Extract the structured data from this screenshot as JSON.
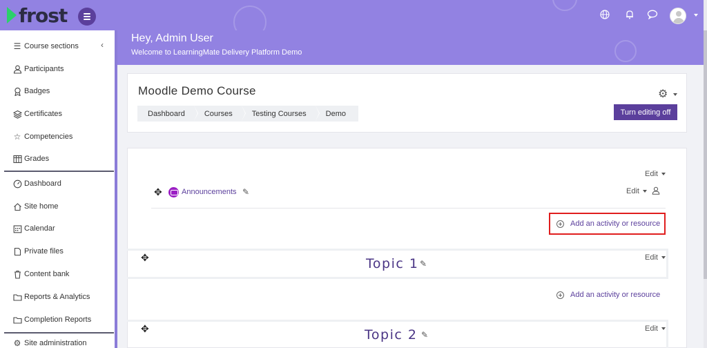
{
  "header": {
    "logo_text": "frost",
    "greeting": "Hey, Admin User",
    "welcome": "Welcome to LearningMate Delivery Platform Demo",
    "icons": [
      "menu-icon",
      "globe-icon",
      "bell-icon",
      "chat-icon",
      "avatar-icon"
    ]
  },
  "sidebar": {
    "items": [
      {
        "label": "Course sections",
        "icon": "list-icon"
      },
      {
        "label": "Participants",
        "icon": "users-icon"
      },
      {
        "label": "Badges",
        "icon": "badge-icon"
      },
      {
        "label": "Certificates",
        "icon": "layers-icon"
      },
      {
        "label": "Competencies",
        "icon": "star-icon"
      },
      {
        "label": "Grades",
        "icon": "table-icon"
      },
      {
        "label": "Dashboard",
        "icon": "gauge-icon"
      },
      {
        "label": "Site home",
        "icon": "home-icon"
      },
      {
        "label": "Calendar",
        "icon": "calendar-icon"
      },
      {
        "label": "Private files",
        "icon": "file-icon"
      },
      {
        "label": "Content bank",
        "icon": "trash-icon"
      },
      {
        "label": "Reports & Analytics",
        "icon": "folder-icon"
      },
      {
        "label": "Completion Reports",
        "icon": "folder-icon"
      },
      {
        "label": "Site administration",
        "icon": "gear-icon"
      }
    ]
  },
  "course": {
    "title": "Moodle Demo Course",
    "breadcrumb": [
      "Dashboard",
      "Courses",
      "Testing Courses",
      "Demo"
    ],
    "editing_button": "Turn editing off"
  },
  "content": {
    "edit_label": "Edit",
    "announcements": "Announcements",
    "add_activity": "Add an activity or resource",
    "topics": [
      "Topic 1",
      "Topic 2"
    ]
  },
  "colors": {
    "header": "#9282e2",
    "accent": "#5b3f9c",
    "brand_green": "#2bd16a",
    "highlight": "#e01d1d"
  }
}
